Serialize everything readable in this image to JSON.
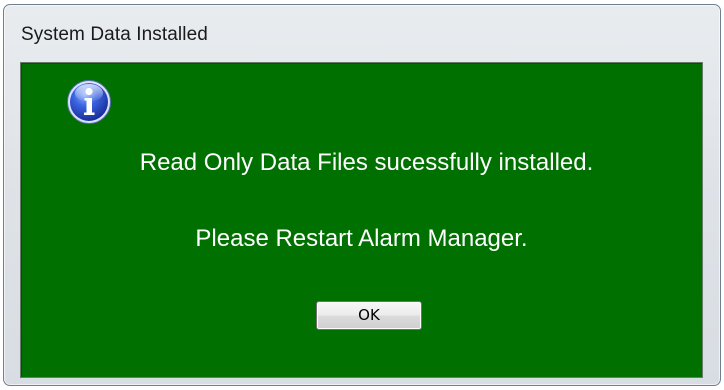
{
  "window": {
    "title": "System Data Installed"
  },
  "message": {
    "icon": "info-icon",
    "line1": "Read Only Data Files sucessfully installed.",
    "line2": "Please Restart Alarm Manager."
  },
  "buttons": {
    "ok_label": "OK"
  },
  "colors": {
    "content_background": "#007000",
    "message_text": "#ffffff",
    "icon_blue": "#2a4fd0"
  }
}
